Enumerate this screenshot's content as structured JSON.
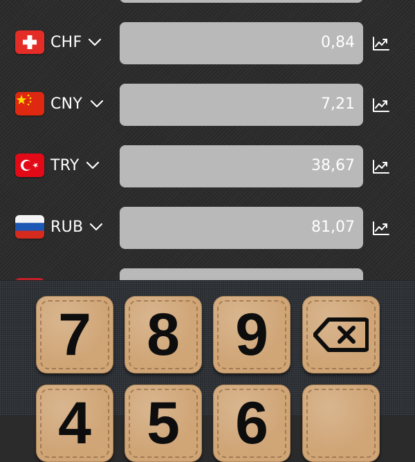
{
  "currencies": [
    {
      "code": "CHF",
      "value": "0,84",
      "flag": "switzerland"
    },
    {
      "code": "CNY",
      "value": "7,21",
      "flag": "china"
    },
    {
      "code": "TRY",
      "value": "38,67",
      "flag": "turkey"
    },
    {
      "code": "RUB",
      "value": "81,07",
      "flag": "russia"
    },
    {
      "code": "",
      "value": "",
      "flag": "partial"
    }
  ],
  "icons": {
    "dropdown": "chevron-down-icon",
    "chart": "trend-chart-icon",
    "backspace": "backspace-icon"
  },
  "keypad": {
    "keys": [
      "7",
      "8",
      "9",
      "backspace",
      "4",
      "5",
      "6",
      ""
    ]
  },
  "colors": {
    "field_bg": "#b9b9b9",
    "key_bg": "#d2a778",
    "key_text": "#0d0d0d"
  }
}
